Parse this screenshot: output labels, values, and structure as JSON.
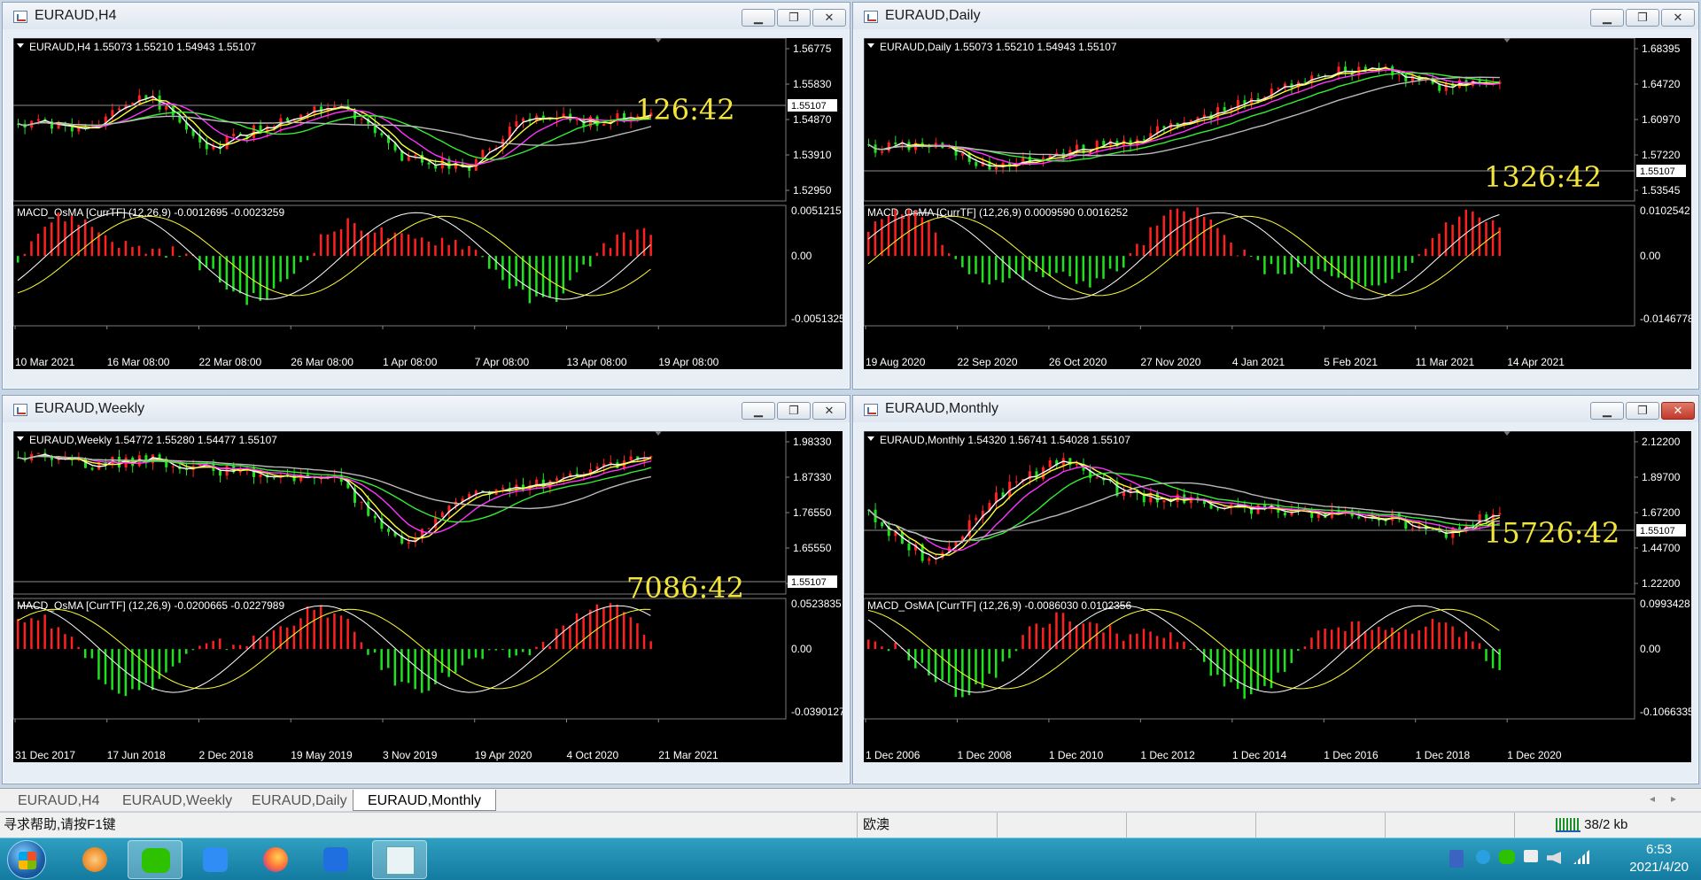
{
  "windows": [
    {
      "title": "EURAUD,H4",
      "header": "EURAUD,H4  1.55073 1.55210 1.54943 1.55107",
      "timer": "126:42",
      "price_labels": [
        "1.56775",
        "1.55830",
        "1.54870",
        "1.53910",
        "1.52950"
      ],
      "current_price": "1.55107",
      "macd_header": "MACD_OsMA [CurrTF] (12,26,9) -0.0012695 -0.0023259",
      "macd_labels": [
        "0.0051215",
        "0.00",
        "-0.0051325"
      ],
      "dates": [
        "10 Mar 2021",
        "16 Mar 08:00",
        "22 Mar 08:00",
        "26 Mar 08:00",
        "1 Apr 08:00",
        "7 Apr 08:00",
        "13 Apr 08:00",
        "19 Apr 08:00"
      ],
      "close_style": "normal"
    },
    {
      "title": "EURAUD,Daily",
      "header": "EURAUD,Daily  1.55073 1.55210 1.54943 1.55107",
      "timer": "1326:42",
      "price_labels": [
        "1.68395",
        "1.64720",
        "1.60970",
        "1.57220",
        "1.53545"
      ],
      "current_price": "1.55107",
      "macd_header": "MACD_OsMA [CurrTF] (12,26,9) 0.0009590 0.0016252",
      "macd_labels": [
        "0.0102542",
        "0.00",
        "-0.0146778"
      ],
      "dates": [
        "19 Aug 2020",
        "22 Sep 2020",
        "26 Oct 2020",
        "27 Nov 2020",
        "4 Jan 2021",
        "5 Feb 2021",
        "11 Mar 2021",
        "14 Apr 2021"
      ],
      "close_style": "normal"
    },
    {
      "title": "EURAUD,Weekly",
      "header": "EURAUD,Weekly  1.54772 1.55280 1.54477 1.55107",
      "timer": "7086:42",
      "price_labels": [
        "1.98330",
        "1.87330",
        "1.76550",
        "1.65550",
        "1.55107"
      ],
      "current_price": "1.55107",
      "macd_header": "MACD_OsMA [CurrTF] (12,26,9) -0.0200665 -0.0227989",
      "macd_labels": [
        "0.0523835",
        "0.00",
        "-0.0390127"
      ],
      "dates": [
        "31 Dec 2017",
        "17 Jun 2018",
        "2 Dec 2018",
        "19 May 2019",
        "3 Nov 2019",
        "19 Apr 2020",
        "4 Oct 2020",
        "21 Mar 2021"
      ],
      "close_style": "normal"
    },
    {
      "title": "EURAUD,Monthly",
      "header": "EURAUD,Monthly  1.54320 1.56741 1.54028 1.55107",
      "timer": "15726:42",
      "price_labels": [
        "2.12200",
        "1.89700",
        "1.67200",
        "1.44700",
        "1.22200"
      ],
      "current_price": "1.55107",
      "macd_header": "MACD_OsMA [CurrTF] (12,26,9) -0.0086030 0.0102356",
      "macd_labels": [
        "0.0993428",
        "0.00",
        "-0.1066335"
      ],
      "dates": [
        "1 Dec 2006",
        "1 Dec 2008",
        "1 Dec 2010",
        "1 Dec 2012",
        "1 Dec 2014",
        "1 Dec 2016",
        "1 Dec 2018",
        "1 Dec 2020"
      ],
      "close_style": "red"
    }
  ],
  "window_buttons": {
    "minimize": "▁",
    "restore": "❐",
    "close": "✕"
  },
  "tabs": [
    "EURAUD,H4",
    "EURAUD,Weekly",
    "EURAUD,Daily",
    "EURAUD,Monthly"
  ],
  "active_tab": 3,
  "status": {
    "help": "寻求帮助,请按F1键",
    "profile": "欧澳",
    "traffic": "38/2 kb"
  },
  "clock": {
    "time": "6:53",
    "date": "2021/4/20"
  },
  "colors": {
    "bull": "#ff2020",
    "bear": "#1ee21e",
    "ma_white": "#ffffff",
    "ma_yellow": "#ffff33",
    "ma_magenta": "#ff33ff",
    "ma_green": "#33ee33",
    "ma_gray": "#b9b9b9",
    "timer": "#f2e43a"
  }
}
